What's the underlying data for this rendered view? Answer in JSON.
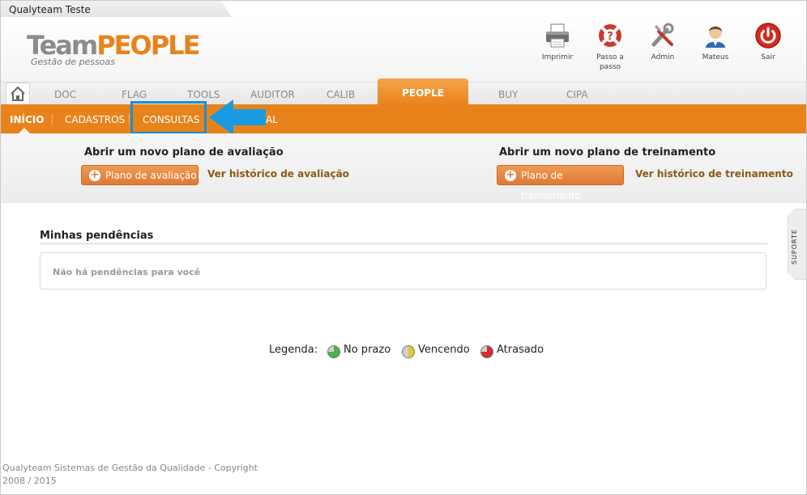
{
  "window": {
    "title": "Qualyteam Teste"
  },
  "logo": {
    "team": "Team",
    "people": "PEOPLE",
    "subtitle": "Gestão de pessoas"
  },
  "toolbar": [
    {
      "label": "Imprimir",
      "icon": "printer-icon"
    },
    {
      "label": "Passo a passo",
      "icon": "lifebuoy-help-icon"
    },
    {
      "label": "Admin",
      "icon": "wrench-tools-icon"
    },
    {
      "label": "Mateus",
      "icon": "user-avatar-icon"
    },
    {
      "label": "Sair",
      "icon": "power-icon"
    }
  ],
  "modules": [
    "DOC",
    "FLAG",
    "TOOLS",
    "AUDITOR",
    "CALIB",
    "PEOPLE",
    "BUY",
    "CIPA"
  ],
  "active_module": "PEOPLE",
  "submenu": [
    "INÍCIO",
    "CADASTROS",
    "CONSULTAS",
    "AL"
  ],
  "active_submenu": "INÍCIO",
  "highlighted_submenu": "CONSULTAS",
  "actions": {
    "evaluation": {
      "title": "Abrir um novo plano de avaliação",
      "button": "Plano de avaliação",
      "link": "Ver histórico de avaliação"
    },
    "training": {
      "title": "Abrir um novo plano de treinamento",
      "button": "Plano de treinamento",
      "link": "Ver histórico de treinamento"
    }
  },
  "support": {
    "label": "SUPORTE"
  },
  "pending": {
    "title": "Minhas pendências",
    "empty": "Não há pendências para você"
  },
  "legend": {
    "label": "Legenda:",
    "items": [
      {
        "label": "No prazo",
        "color": "#4caf50"
      },
      {
        "label": "Vencendo",
        "color": "#e8c82a"
      },
      {
        "label": "Atrasado",
        "color": "#d32f2f"
      }
    ]
  },
  "footer": {
    "text": "Qualyteam Sistemas de Gestão da Qualidade - Copyright 2008 / 2015"
  },
  "colors": {
    "accent": "#e8831c",
    "highlight": "#1a8fd6"
  }
}
